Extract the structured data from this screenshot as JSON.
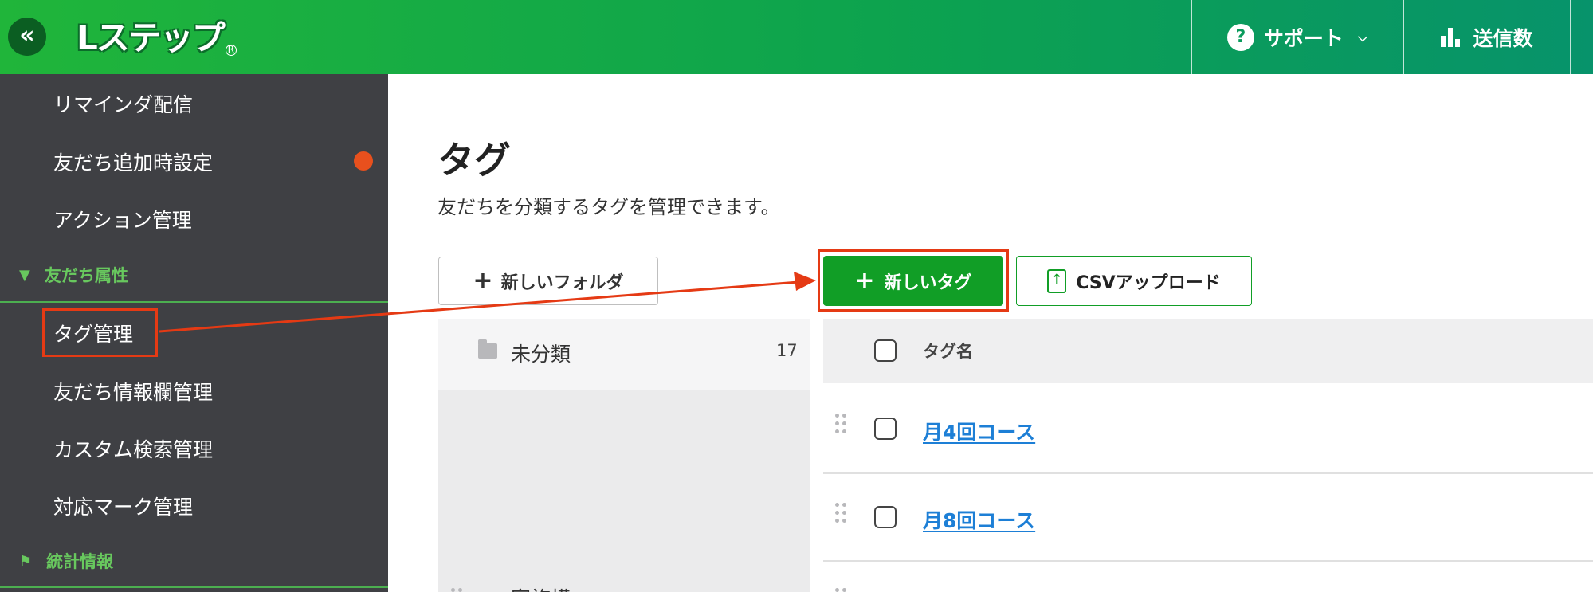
{
  "header": {
    "collapse_label": "«",
    "logo_text": "Lステップ",
    "logo_mark": "R",
    "support_label": "サポート",
    "sends_label": "送信数"
  },
  "sidebar": {
    "items": [
      {
        "label": "リマインダ配信"
      },
      {
        "label": "友だち追加時設定"
      },
      {
        "label": "アクション管理"
      },
      {
        "label": "タグ管理"
      },
      {
        "label": "友だち情報欄管理"
      },
      {
        "label": "カスタム検索管理"
      },
      {
        "label": "対応マーク管理"
      }
    ],
    "sections": [
      {
        "label": "友だち属性",
        "icon": "funnel-icon"
      },
      {
        "label": "統計情報",
        "icon": "flag-icon"
      }
    ],
    "notification_color": "#e8501d"
  },
  "main": {
    "title": "タグ",
    "description": "友だちを分類するタグを管理できます。",
    "new_folder_label": "新しいフォルダ",
    "new_tag_label": "新しいタグ",
    "csv_upload_label": "CSVアップロード",
    "plus_glyph": "+"
  },
  "folders": {
    "items": [
      {
        "label": "未分類",
        "count": "17"
      }
    ],
    "partial_label": "家族構"
  },
  "tags_table": {
    "header": "タグ名",
    "rows": [
      {
        "name": "月4回コース"
      },
      {
        "name": "月8回コース"
      }
    ]
  },
  "colors": {
    "brand_green": "#119e26",
    "highlight_red": "#e53a14",
    "link_blue": "#1d7fd6",
    "sidebar_bg": "#3f4044"
  }
}
